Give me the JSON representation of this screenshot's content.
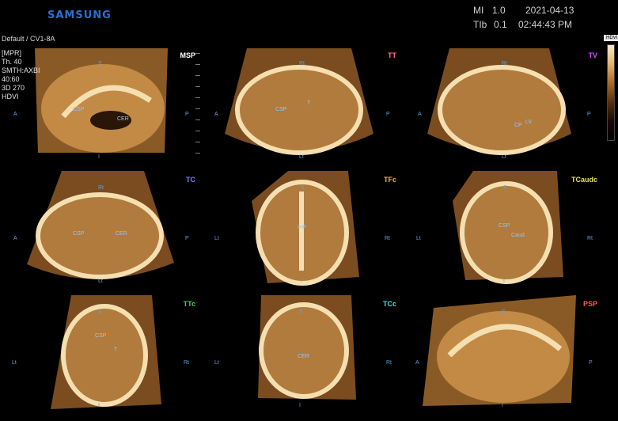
{
  "header": {
    "brand": "SAMSUNG",
    "preset": "Default / CV1-8A",
    "mi_label": "MI",
    "mi_value": "1.0",
    "tib_label": "TIb",
    "tib_value": "0.1",
    "date": "2021-04-13",
    "time": "02:44:43 PM"
  },
  "mpr_info": "[MPR]\nTh. 40\nSMTH:AXBI\n40:60\n3D 270\nHDVI",
  "colorbar_label": "HDVI",
  "colors": {
    "brand": "#2a6fd6",
    "orientation_label": "#5aa2e8"
  },
  "panels": [
    {
      "title": "MSP",
      "title_color": "#ffffff",
      "left": "A",
      "right": "P",
      "top": "S",
      "bottom": "I",
      "labels": [
        "CSP",
        "CER"
      ]
    },
    {
      "title": "TT",
      "title_color": "#ff6aa0",
      "left": "A",
      "right": "P",
      "top": "Rt",
      "bottom": "Lt",
      "labels": [
        "CSP",
        "T"
      ]
    },
    {
      "title": "TV",
      "title_color": "#d84cff",
      "left": "A",
      "right": "P",
      "top": "Rt",
      "bottom": "Lt",
      "labels": [
        "CP",
        "LV"
      ]
    },
    {
      "title": "TC",
      "title_color": "#7e7eff",
      "left": "A",
      "right": "P",
      "top": "Rt",
      "bottom": "Lt",
      "labels": [
        "CSP",
        "CER"
      ]
    },
    {
      "title": "TFc",
      "title_color": "#f0b040",
      "left": "Lt",
      "right": "Rt",
      "top": "S",
      "bottom": "I",
      "labels": [
        "IHF"
      ]
    },
    {
      "title": "TCaudc",
      "title_color": "#e6e060",
      "left": "Lt",
      "right": "Rt",
      "top": "S",
      "bottom": "I",
      "labels": [
        "CSP",
        "Caud"
      ]
    },
    {
      "title": "TTc",
      "title_color": "#40d040",
      "left": "Lt",
      "right": "Rt",
      "top": "S",
      "bottom": "I",
      "labels": [
        "CSP",
        "T"
      ]
    },
    {
      "title": "TCc",
      "title_color": "#40e0e0",
      "left": "Lt",
      "right": "Rt",
      "top": "S",
      "bottom": "I",
      "labels": [
        "CER"
      ]
    },
    {
      "title": "PSP",
      "title_color": "#ff5a3a",
      "left": "A",
      "right": "P",
      "top": "S",
      "bottom": "I",
      "labels": []
    }
  ]
}
